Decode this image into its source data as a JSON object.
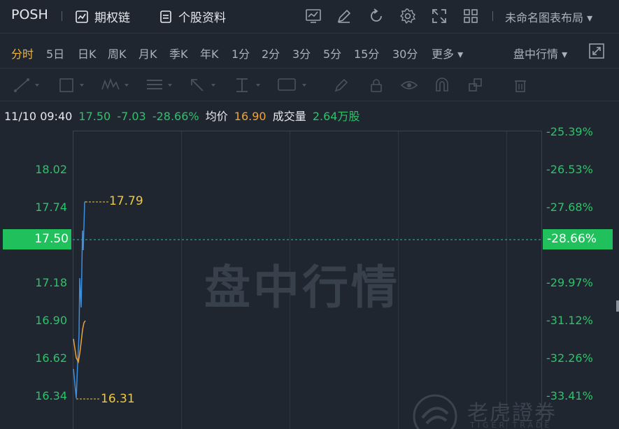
{
  "header": {
    "symbol": "POSH",
    "option_chain": "期权链",
    "stock_profile": "个股资料",
    "layout_name": "未命名图表布局 ▾"
  },
  "periods": [
    {
      "label": "分时",
      "active": true
    },
    {
      "label": "5日"
    },
    {
      "label": "日K"
    },
    {
      "label": "周K"
    },
    {
      "label": "月K"
    },
    {
      "label": "季K"
    },
    {
      "label": "年K"
    },
    {
      "label": "1分"
    },
    {
      "label": "2分"
    },
    {
      "label": "3分"
    },
    {
      "label": "5分"
    },
    {
      "label": "15分"
    },
    {
      "label": "30分"
    },
    {
      "label": "更多 ▾"
    }
  ],
  "mode_label": "盘中行情 ▾",
  "info": {
    "datetime": "11/10 09:40",
    "price": "17.50",
    "change": "-7.03",
    "change_pct": "-28.66%",
    "avg_label": "均价",
    "avg_value": "16.90",
    "volume_label": "成交量",
    "volume_value": "2.64万股"
  },
  "y_left": [
    "18.02",
    "17.74",
    "17.50",
    "17.18",
    "16.90",
    "16.62",
    "16.34"
  ],
  "y_right": [
    "-25.39%",
    "-26.53%",
    "-27.68%",
    "-28.66%",
    "-29.97%",
    "-31.12%",
    "-32.26%",
    "-33.41%"
  ],
  "high_label": "17.79",
  "low_label": "16.31",
  "watermark": "盘中行情",
  "brand": {
    "name": "老虎證券",
    "sub": "TIGER TRADE"
  },
  "colors": {
    "up_down_green": "#2ec26a",
    "accent_orange": "#f0b43c",
    "price_line": "#3d8fe0",
    "avg_line": "#f0a33a"
  }
}
